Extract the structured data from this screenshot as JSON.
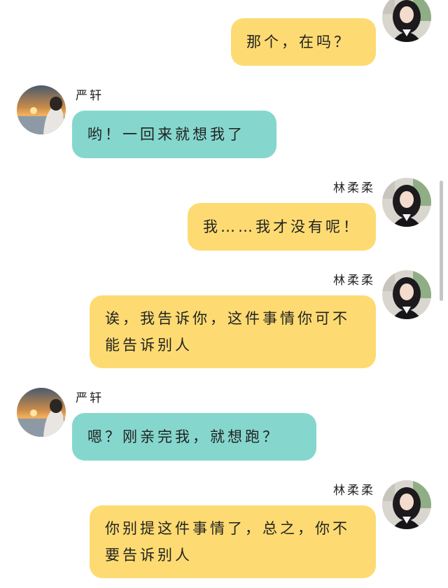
{
  "chat": {
    "contacts": {
      "other_name": "严轩",
      "me_name": "林柔柔"
    },
    "messages": [
      {
        "from": "me",
        "text": "那个，在吗？"
      },
      {
        "from": "other",
        "text": "哟！一回来就想我了"
      },
      {
        "from": "me",
        "text": "我……我才没有呢！"
      },
      {
        "from": "me",
        "text": "诶，我告诉你，这件事情你可不能告诉别人"
      },
      {
        "from": "other",
        "text": "嗯？刚亲完我，就想跑？"
      },
      {
        "from": "me",
        "text": "你别提这件事情了，总之，你不要告诉别人"
      }
    ]
  },
  "colors": {
    "my_bubble": "#fddb72",
    "their_bubble": "#85d7cd",
    "background": "#ffffff"
  },
  "icons": {
    "other_avatar": "sunset-portrait-avatar",
    "me_avatar": "girl-portrait-avatar"
  }
}
